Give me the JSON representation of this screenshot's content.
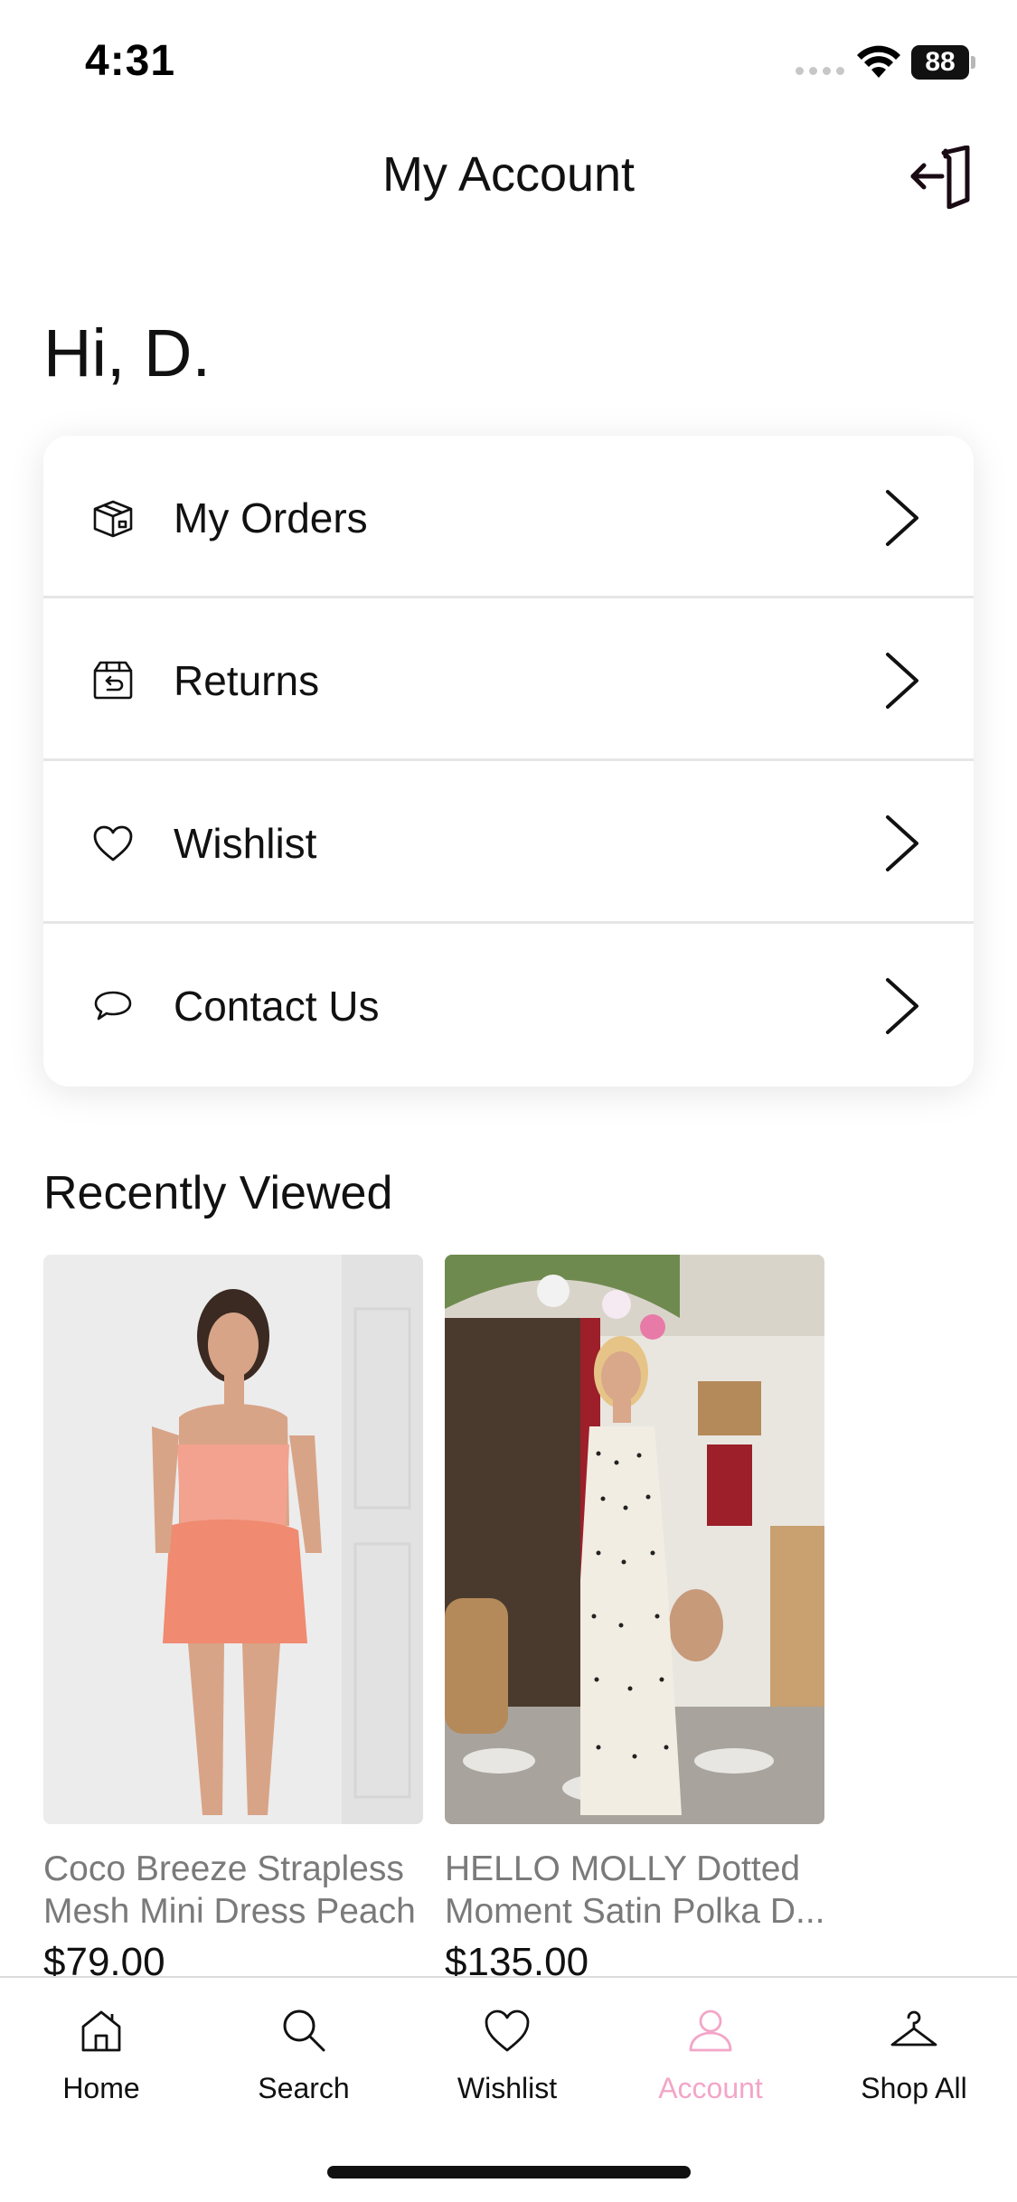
{
  "status_bar": {
    "time": "4:31",
    "battery": "88"
  },
  "header": {
    "title": "My Account",
    "logout_icon": "logout-icon"
  },
  "greeting": "Hi,  D.",
  "menu": [
    {
      "label": "My Orders",
      "icon": "box-icon"
    },
    {
      "label": "Returns",
      "icon": "return-box-icon"
    },
    {
      "label": "Wishlist",
      "icon": "heart-icon"
    },
    {
      "label": "Contact Us",
      "icon": "chat-bubble-icon"
    }
  ],
  "recently_viewed": {
    "title": "Recently Viewed",
    "products": [
      {
        "name_line1": "Coco Breeze Strapless",
        "name_line2": "Mesh Mini Dress Peach",
        "price": "$79.00"
      },
      {
        "name_line1": "HELLO MOLLY Dotted",
        "name_line2": "Moment Satin Polka D...",
        "price": "$135.00"
      }
    ]
  },
  "tabs": [
    {
      "label": "Home",
      "icon": "home-icon",
      "active": false
    },
    {
      "label": "Search",
      "icon": "search-icon",
      "active": false
    },
    {
      "label": "Wishlist",
      "icon": "heart-icon",
      "active": false
    },
    {
      "label": "Account",
      "icon": "person-icon",
      "active": true
    },
    {
      "label": "Shop All",
      "icon": "hanger-icon",
      "active": false
    }
  ],
  "colors": {
    "accent": "#f3a6c8",
    "text": "#111111",
    "muted": "#7a7a7a"
  }
}
